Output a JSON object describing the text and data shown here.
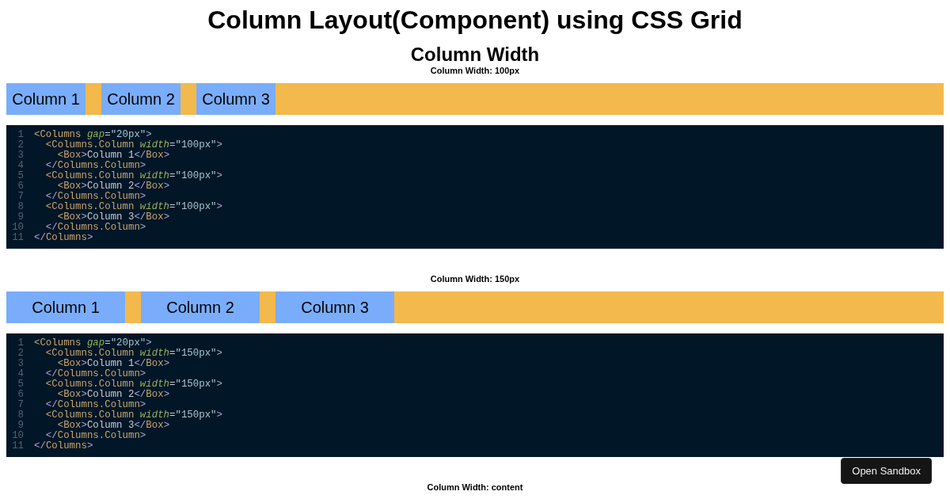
{
  "title": "Column Layout(Component) using CSS Grid",
  "heading": "Column Width",
  "examples": [
    {
      "label": "Column Width: 100px",
      "kind": "narrow",
      "columns": [
        {
          "text": "Column 1"
        },
        {
          "text": "Column 2"
        },
        {
          "text": "Column 3"
        }
      ],
      "code": [
        {
          "number": "1",
          "tokens": [
            {
              "kind": "tag",
              "text": "<Columns"
            },
            {
              "kind": "attr",
              "text": " gap"
            },
            {
              "kind": "eq",
              "text": "="
            },
            {
              "kind": "string",
              "text": "\"20px\""
            },
            {
              "kind": "punct",
              "text": ">"
            }
          ]
        },
        {
          "number": "2",
          "tokens": [
            {
              "kind": "tag",
              "text": "  <Columns.Column"
            },
            {
              "kind": "attr",
              "text": " width"
            },
            {
              "kind": "eq",
              "text": "="
            },
            {
              "kind": "string",
              "text": "\"100px\""
            },
            {
              "kind": "punct",
              "text": ">"
            }
          ]
        },
        {
          "number": "3",
          "tokens": [
            {
              "kind": "tag",
              "text": "    <Box"
            },
            {
              "kind": "punct",
              "text": ">"
            },
            {
              "kind": "text",
              "text": "Column 1"
            },
            {
              "kind": "punct",
              "text": "</"
            },
            {
              "kind": "tag",
              "text": "Box"
            },
            {
              "kind": "punct",
              "text": ">"
            }
          ]
        },
        {
          "number": "4",
          "tokens": [
            {
              "kind": "punct",
              "text": "  </"
            },
            {
              "kind": "tag",
              "text": "Columns.Column"
            },
            {
              "kind": "punct",
              "text": ">"
            }
          ]
        },
        {
          "number": "5",
          "tokens": [
            {
              "kind": "tag",
              "text": "  <Columns.Column"
            },
            {
              "kind": "attr",
              "text": " width"
            },
            {
              "kind": "eq",
              "text": "="
            },
            {
              "kind": "string",
              "text": "\"100px\""
            },
            {
              "kind": "punct",
              "text": ">"
            }
          ]
        },
        {
          "number": "6",
          "tokens": [
            {
              "kind": "tag",
              "text": "    <Box"
            },
            {
              "kind": "punct",
              "text": ">"
            },
            {
              "kind": "text",
              "text": "Column 2"
            },
            {
              "kind": "punct",
              "text": "</"
            },
            {
              "kind": "tag",
              "text": "Box"
            },
            {
              "kind": "punct",
              "text": ">"
            }
          ]
        },
        {
          "number": "7",
          "tokens": [
            {
              "kind": "punct",
              "text": "  </"
            },
            {
              "kind": "tag",
              "text": "Columns.Column"
            },
            {
              "kind": "punct",
              "text": ">"
            }
          ]
        },
        {
          "number": "8",
          "tokens": [
            {
              "kind": "tag",
              "text": "  <Columns.Column"
            },
            {
              "kind": "attr",
              "text": " width"
            },
            {
              "kind": "eq",
              "text": "="
            },
            {
              "kind": "string",
              "text": "\"100px\""
            },
            {
              "kind": "punct",
              "text": ">"
            }
          ]
        },
        {
          "number": "9",
          "tokens": [
            {
              "kind": "tag",
              "text": "    <Box"
            },
            {
              "kind": "punct",
              "text": ">"
            },
            {
              "kind": "text",
              "text": "Column 3"
            },
            {
              "kind": "punct",
              "text": "</"
            },
            {
              "kind": "tag",
              "text": "Box"
            },
            {
              "kind": "punct",
              "text": ">"
            }
          ]
        },
        {
          "number": "10",
          "tokens": [
            {
              "kind": "punct",
              "text": "  </"
            },
            {
              "kind": "tag",
              "text": "Columns.Column"
            },
            {
              "kind": "punct",
              "text": ">"
            }
          ]
        },
        {
          "number": "11",
          "tokens": [
            {
              "kind": "punct",
              "text": "</"
            },
            {
              "kind": "tag",
              "text": "Columns"
            },
            {
              "kind": "punct",
              "text": ">"
            }
          ]
        }
      ]
    },
    {
      "label": "Column Width: 150px",
      "kind": "wide",
      "columns": [
        {
          "text": "Column 1"
        },
        {
          "text": "Column 2"
        },
        {
          "text": "Column 3"
        }
      ],
      "code": [
        {
          "number": "1",
          "tokens": [
            {
              "kind": "tag",
              "text": "<Columns"
            },
            {
              "kind": "attr",
              "text": " gap"
            },
            {
              "kind": "eq",
              "text": "="
            },
            {
              "kind": "string",
              "text": "\"20px\""
            },
            {
              "kind": "punct",
              "text": ">"
            }
          ]
        },
        {
          "number": "2",
          "tokens": [
            {
              "kind": "tag",
              "text": "  <Columns.Column"
            },
            {
              "kind": "attr",
              "text": " width"
            },
            {
              "kind": "eq",
              "text": "="
            },
            {
              "kind": "string",
              "text": "\"150px\""
            },
            {
              "kind": "punct",
              "text": ">"
            }
          ]
        },
        {
          "number": "3",
          "tokens": [
            {
              "kind": "tag",
              "text": "    <Box"
            },
            {
              "kind": "punct",
              "text": ">"
            },
            {
              "kind": "text",
              "text": "Column 1"
            },
            {
              "kind": "punct",
              "text": "</"
            },
            {
              "kind": "tag",
              "text": "Box"
            },
            {
              "kind": "punct",
              "text": ">"
            }
          ]
        },
        {
          "number": "4",
          "tokens": [
            {
              "kind": "punct",
              "text": "  </"
            },
            {
              "kind": "tag",
              "text": "Columns.Column"
            },
            {
              "kind": "punct",
              "text": ">"
            }
          ]
        },
        {
          "number": "5",
          "tokens": [
            {
              "kind": "tag",
              "text": "  <Columns.Column"
            },
            {
              "kind": "attr",
              "text": " width"
            },
            {
              "kind": "eq",
              "text": "="
            },
            {
              "kind": "string",
              "text": "\"150px\""
            },
            {
              "kind": "punct",
              "text": ">"
            }
          ]
        },
        {
          "number": "6",
          "tokens": [
            {
              "kind": "tag",
              "text": "    <Box"
            },
            {
              "kind": "punct",
              "text": ">"
            },
            {
              "kind": "text",
              "text": "Column 2"
            },
            {
              "kind": "punct",
              "text": "</"
            },
            {
              "kind": "tag",
              "text": "Box"
            },
            {
              "kind": "punct",
              "text": ">"
            }
          ]
        },
        {
          "number": "7",
          "tokens": [
            {
              "kind": "punct",
              "text": "  </"
            },
            {
              "kind": "tag",
              "text": "Columns.Column"
            },
            {
              "kind": "punct",
              "text": ">"
            }
          ]
        },
        {
          "number": "8",
          "tokens": [
            {
              "kind": "tag",
              "text": "  <Columns.Column"
            },
            {
              "kind": "attr",
              "text": " width"
            },
            {
              "kind": "eq",
              "text": "="
            },
            {
              "kind": "string",
              "text": "\"150px\""
            },
            {
              "kind": "punct",
              "text": ">"
            }
          ]
        },
        {
          "number": "9",
          "tokens": [
            {
              "kind": "tag",
              "text": "    <Box"
            },
            {
              "kind": "punct",
              "text": ">"
            },
            {
              "kind": "text",
              "text": "Column 3"
            },
            {
              "kind": "punct",
              "text": "</"
            },
            {
              "kind": "tag",
              "text": "Box"
            },
            {
              "kind": "punct",
              "text": ">"
            }
          ]
        },
        {
          "number": "10",
          "tokens": [
            {
              "kind": "punct",
              "text": "  </"
            },
            {
              "kind": "tag",
              "text": "Columns.Column"
            },
            {
              "kind": "punct",
              "text": ">"
            }
          ]
        },
        {
          "number": "11",
          "tokens": [
            {
              "kind": "punct",
              "text": "</"
            },
            {
              "kind": "tag",
              "text": "Columns"
            },
            {
              "kind": "punct",
              "text": ">"
            }
          ]
        }
      ]
    },
    {
      "label": "Column Width: content"
    }
  ],
  "sandbox_button": "Open Sandbox"
}
